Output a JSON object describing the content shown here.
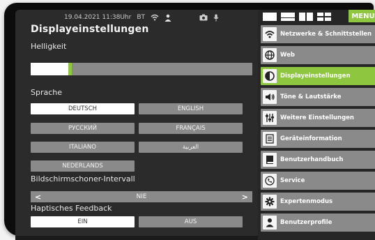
{
  "status_bar": {
    "datetime": "19.04.2021 11:38Uhr",
    "bt_label": "BT",
    "icons": [
      "wifi-icon",
      "person-icon",
      "camera-icon",
      "microphone-icon"
    ]
  },
  "page": {
    "title": "Displayeinstellungen"
  },
  "brightness": {
    "label": "Helligkeit",
    "level_percent": 17
  },
  "language": {
    "label": "Sprache",
    "options": [
      {
        "label": "DEUTSCH",
        "selected": true
      },
      {
        "label": "ENGLISH",
        "selected": false
      },
      {
        "label": "РУССКИЙ",
        "selected": false
      },
      {
        "label": "FRANÇAIS",
        "selected": false
      },
      {
        "label": "ITALIANO",
        "selected": false
      },
      {
        "label": "العربية",
        "selected": false
      },
      {
        "label": "NEDERLANDS",
        "selected": false
      }
    ]
  },
  "screensaver": {
    "label": "Bildschirmschoner-Intervall",
    "value": "NIE",
    "prev": "<",
    "next": ">"
  },
  "haptic": {
    "label": "Haptisches Feedback",
    "on_label": "EIN",
    "off_label": "AUS",
    "selected": "EIN"
  },
  "view_toggle": {
    "icons": [
      "view-single-icon",
      "view-list-icon",
      "view-columns-icon",
      "view-grid-icon"
    ],
    "menu_label": "MENU"
  },
  "nav": [
    {
      "label": "Netzwerke & Schnittstellen",
      "icon": "wifi-icon",
      "active": false
    },
    {
      "label": "Web",
      "icon": "globe-icon",
      "active": false
    },
    {
      "label": "Displayeinstellungen",
      "icon": "contrast-icon",
      "active": true
    },
    {
      "label": "Töne & Lautstärke",
      "icon": "speaker-icon",
      "active": false
    },
    {
      "label": "Weitere Einstellungen",
      "icon": "sliders-icon",
      "active": false
    },
    {
      "label": "Geräteinformation",
      "icon": "document-icon",
      "active": false
    },
    {
      "label": "Benutzerhandbuch",
      "icon": "book-icon",
      "active": false
    },
    {
      "label": "Service",
      "icon": "phone-icon",
      "active": false
    },
    {
      "label": "Expertenmodus",
      "icon": "gear-icon",
      "active": false
    },
    {
      "label": "Benutzerprofile",
      "icon": "user-profile-icon",
      "active": false
    }
  ],
  "colors": {
    "accent": "#8ec63f",
    "button_gray": "#8a8a8a",
    "panel_dark": "#2b2b2b"
  }
}
